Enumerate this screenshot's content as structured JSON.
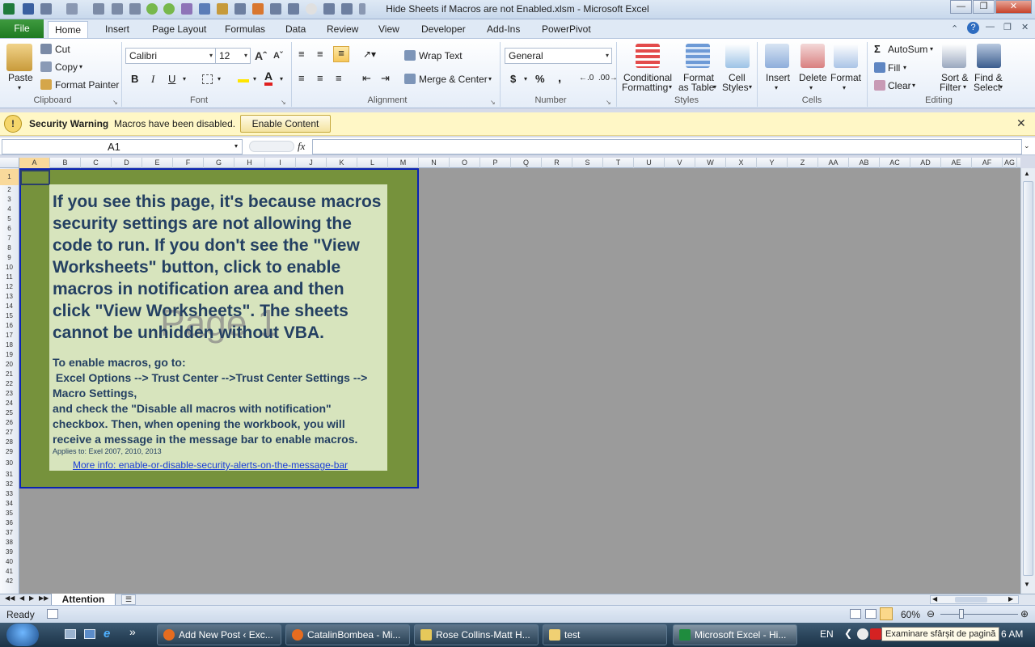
{
  "window": {
    "title": "Hide Sheets if Macros are not Enabled.xlsm  -  Microsoft Excel"
  },
  "ribbon_tabs": {
    "file": "File",
    "items": [
      "Home",
      "Insert",
      "Page Layout",
      "Formulas",
      "Data",
      "Review",
      "View",
      "Developer",
      "Add-Ins",
      "PowerPivot"
    ]
  },
  "clipboard": {
    "paste": "Paste",
    "cut": "Cut",
    "copy": "Copy",
    "format_painter": "Format Painter",
    "label": "Clipboard"
  },
  "font": {
    "name": "Calibri",
    "size": "12",
    "bold": "B",
    "italic": "I",
    "underline": "U",
    "label": "Font"
  },
  "alignment": {
    "wrap_text": "Wrap Text",
    "merge_center": "Merge & Center",
    "label": "Alignment"
  },
  "number": {
    "format": "General",
    "currency": "$",
    "percent": "%",
    "comma": ",",
    "label": "Number"
  },
  "styles": {
    "conditional": "Conditional",
    "conditional2": "Formatting",
    "format_table": "Format",
    "format_table2": "as Table",
    "cell_styles": "Cell",
    "cell_styles2": "Styles",
    "label": "Styles"
  },
  "cells": {
    "insert": "Insert",
    "delete": "Delete",
    "format": "Format",
    "label": "Cells"
  },
  "editing": {
    "autosum": "AutoSum",
    "fill": "Fill",
    "clear": "Clear",
    "sort_filter": "Sort &",
    "sort_filter2": "Filter",
    "find_select": "Find &",
    "find_select2": "Select",
    "label": "Editing"
  },
  "security_bar": {
    "title": "Security Warning",
    "message": "Macros have been disabled.",
    "button": "Enable Content"
  },
  "formula_bar": {
    "name_box": "A1",
    "fx": "fx",
    "content": ""
  },
  "columns": [
    "A",
    "B",
    "C",
    "D",
    "E",
    "F",
    "G",
    "H",
    "I",
    "J",
    "K",
    "L",
    "M",
    "N",
    "O",
    "P",
    "Q",
    "R",
    "S",
    "T",
    "U",
    "V",
    "W",
    "X",
    "Y",
    "Z",
    "AA",
    "AB",
    "AC",
    "AD",
    "AE",
    "AF",
    "AG"
  ],
  "rows": [
    "1",
    "2",
    "3",
    "4",
    "5",
    "6",
    "7",
    "8",
    "9",
    "10",
    "11",
    "12",
    "13",
    "14",
    "15",
    "16",
    "17",
    "18",
    "19",
    "20",
    "21",
    "22",
    "23",
    "24",
    "25",
    "26",
    "27",
    "28",
    "29",
    "30",
    "31",
    "32",
    "33",
    "34",
    "35",
    "36",
    "37",
    "38",
    "39",
    "40",
    "41",
    "42"
  ],
  "sheet_content": {
    "message_lines": [
      "If you see this page, it's because macros",
      "security settings are not allowing the",
      "code to run. If you don't see the \"View",
      "Worksheets\" button, click to enable",
      "macros in notification area and then",
      "click \"View Worksheets\". The sheets",
      "cannot be unhidden without VBA."
    ],
    "instructions_lines": [
      "To enable macros, go to:",
      " Excel Options --> Trust Center -->Trust Center Settings -->",
      "Macro Settings,",
      "and check the \"Disable all macros with notification\"",
      "checkbox. Then, when opening the workbook, you will",
      "receive a message in the message bar to enable macros."
    ],
    "applies_to": "Applies to: Exel 2007, 2010, 2013",
    "link": "More info: enable-or-disable-security-alerts-on-the-message-bar",
    "watermark": "Page 1"
  },
  "sheet_tabs": {
    "active": "Attention"
  },
  "status_bar": {
    "ready": "Ready",
    "zoom": "60%"
  },
  "taskbar": {
    "items": [
      "Add New Post ‹ Exc...",
      "CatalinBombea - Mi...",
      "Rose Collins-Matt H...",
      "test",
      "Microsoft Excel - Hi..."
    ],
    "lang": "EN",
    "tooltip": "Examinare sfârșit de pagină",
    "clock": "6 AM"
  }
}
